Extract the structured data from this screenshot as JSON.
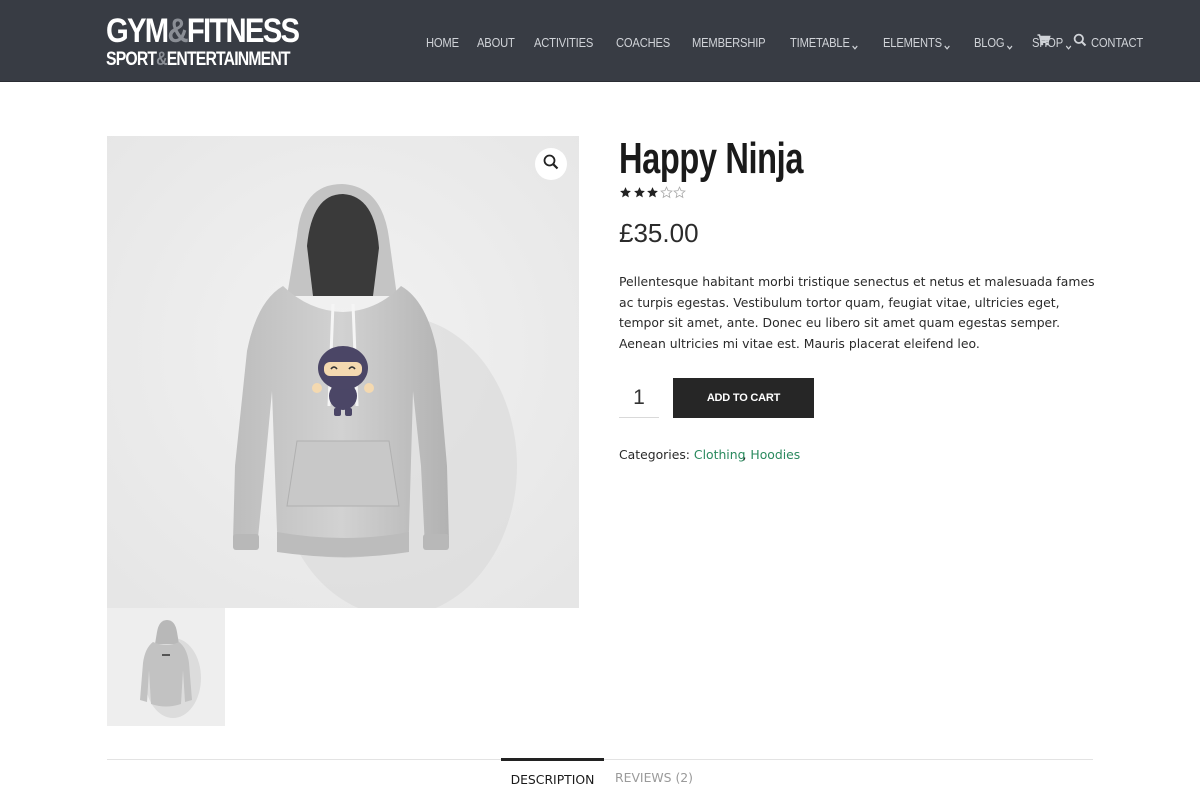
{
  "logo": {
    "line1_a": "GYM",
    "line1_amp": "&",
    "line1_b": "FITNESS",
    "line2_a": "SPORT",
    "line2_amp": "&",
    "line2_b": "ENTERTAINMENT"
  },
  "nav": {
    "items": [
      {
        "label": "HOME",
        "has_dropdown": false
      },
      {
        "label": "ABOUT",
        "has_dropdown": false
      },
      {
        "label": "ACTIVITIES",
        "has_dropdown": false
      },
      {
        "label": "COACHES",
        "has_dropdown": false
      },
      {
        "label": "MEMBERSHIP",
        "has_dropdown": false
      },
      {
        "label": "TIMETABLE",
        "has_dropdown": true
      },
      {
        "label": "ELEMENTS",
        "has_dropdown": true
      },
      {
        "label": "BLOG",
        "has_dropdown": true
      },
      {
        "label": "SHOP",
        "has_dropdown": true
      },
      {
        "label": "CONTACT",
        "has_dropdown": false
      }
    ],
    "icons": [
      "cart-icon",
      "search-icon"
    ]
  },
  "product": {
    "title": "Happy Ninja",
    "rating": 3,
    "rating_max": 5,
    "price": "£35.00",
    "description": "Pellentesque habitant morbi tristique senectus et netus et malesuada fames ac turpis egestas. Vestibulum tortor quam, feugiat vitae, ultricies eget, tempor sit amet, ante. Donec eu libero sit amet quam egestas semper. Aenean ultricies mi vitae est. Mauris placerat eleifend leo.",
    "quantity": "1",
    "add_to_cart_label": "ADD TO CART",
    "categories_label": "Categories:",
    "categories": [
      "Clothing",
      "Hoodies"
    ],
    "categories_separator": ", "
  },
  "tabs": {
    "description": "DESCRIPTION",
    "reviews": "REVIEWS (2)"
  },
  "colors": {
    "header_bg": "#383c44",
    "link_green": "#2a8a5e",
    "button_bg": "#262626"
  }
}
